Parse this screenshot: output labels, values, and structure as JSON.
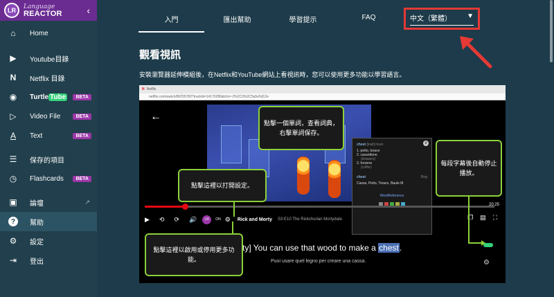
{
  "brand": {
    "logo": "LR",
    "top": "Language",
    "bottom": "REACTOR",
    "collapse": "‹"
  },
  "sidebar": {
    "items": [
      {
        "icon": "⌂",
        "label": "Home"
      },
      {
        "icon": "▶",
        "label": "Youtube目錄"
      },
      {
        "icon": "N",
        "label": "Netflix 目錄"
      },
      {
        "icon": "◉",
        "label_a": "Turtle",
        "label_b": "Tube",
        "beta": "BETA"
      },
      {
        "icon": "▷",
        "label": "Video File",
        "beta": "BETA"
      },
      {
        "icon": "A",
        "label": "Text",
        "beta": "BETA"
      },
      {
        "icon": "☰",
        "label": "保存的項目"
      },
      {
        "icon": "◷",
        "label": "Flashcards",
        "beta": "BETA"
      },
      {
        "icon": "▣",
        "label": "論壇",
        "ext": "↗"
      },
      {
        "icon": "?",
        "label": "幫助"
      },
      {
        "icon": "⚙",
        "label": "設定"
      },
      {
        "icon": "⇥",
        "label": "登出"
      }
    ]
  },
  "tabs": [
    "入門",
    "匯出幫助",
    "學習提示",
    "FAQ"
  ],
  "language": {
    "value": "中文（繁體）",
    "caret": "▼"
  },
  "accent": {
    "highlight": "#e53935",
    "callout_border": "#8dd13a",
    "beta": "#9b37a8"
  },
  "page": {
    "title": "觀看視訊",
    "description": "安裝瀏覽器延伸模組後，在Netflix和YouTube網站上看視訊時，您可以使用更多功能以學習語言。"
  },
  "shot": {
    "chrome_title": "Netflix",
    "url": "netflix.com/watch/80255782?trackId=14170286&tctx=-2%2C3%2C5a5e5d12e",
    "back": "←",
    "time": "20:25",
    "controls": {
      "play": "▶",
      "back10": "⟲",
      "fwd10": "⟳",
      "volume": "🔊",
      "lr": "LR",
      "on": "ON",
      "gear": "⚙"
    },
    "show": "Rick and Morty",
    "episode": "S3:E10  The Rickchurian Mortydate",
    "subtitle_pre": "rty] You can use that wood to make a ",
    "subtitle_word": "chest",
    "subtitle_post": ".",
    "subtitle_translation": "Puoi usare quel legno per creare una cassa.",
    "dict": {
      "head": "chest",
      "pos": "[trad]  noun",
      "defs": [
        "1. petto, torace",
        "2. cassettone",
        "(drawers)",
        "3. forziere",
        "(coffer)"
      ],
      "head2": "chest",
      "freq": "Rng",
      "line2": "Cassa, Petto, Torace, Baule M",
      "link": "WordReference",
      "close": "x"
    }
  },
  "callouts": {
    "word": "點擊一個單詞，查看詞典，右擊單詞保存。",
    "settings": "點擊這裡以打開設定。",
    "autopause": "每段字幕後自動停止播放。",
    "toggle": "點擊這裡以啟用或停用更多功能。"
  }
}
